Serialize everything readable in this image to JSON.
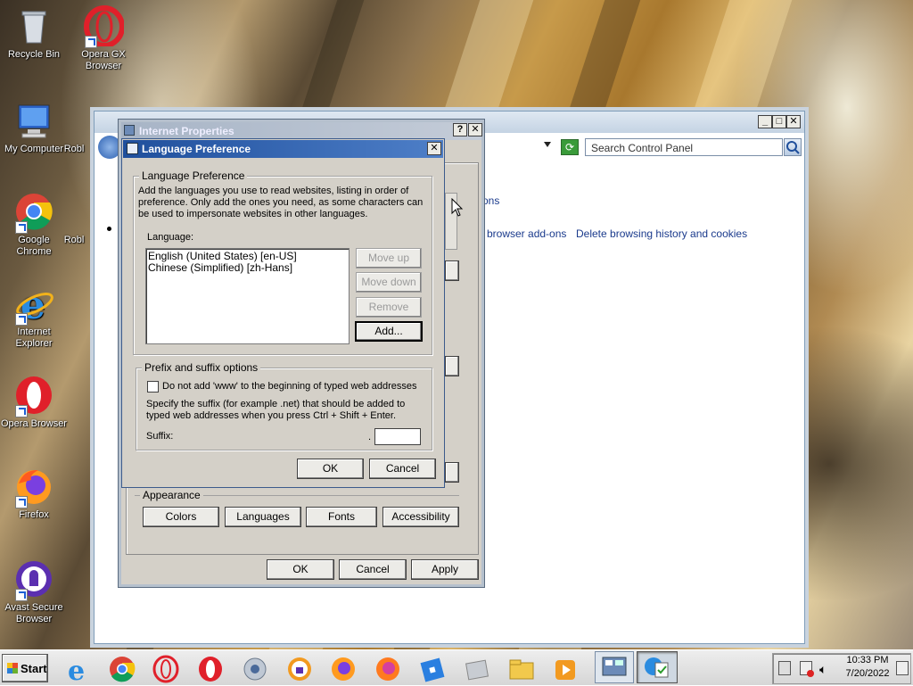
{
  "desktop_icons": [
    {
      "label": "Recycle Bin",
      "icon": "recycle-bin-icon"
    },
    {
      "label": "Opera GX Browser",
      "icon": "opera-gx-icon"
    },
    {
      "label": "My Computer",
      "icon": "my-computer-icon"
    },
    {
      "label": "Robl",
      "icon": "roblox-icon"
    },
    {
      "label": "Google Chrome",
      "icon": "chrome-icon"
    },
    {
      "label": "Robl",
      "icon": "roblox-icon"
    },
    {
      "label": "Internet Explorer",
      "icon": "ie-icon"
    },
    {
      "label": "Opera Browser",
      "icon": "opera-icon"
    },
    {
      "label": "Firefox",
      "icon": "firefox-icon"
    },
    {
      "label": "Avast Secure Browser",
      "icon": "avast-icon"
    }
  ],
  "control_panel": {
    "search_placeholder": "Search Control Panel",
    "link_partial": "ons",
    "link_addons": "browser add-ons",
    "link_delete": "Delete browsing history and cookies"
  },
  "internet_properties": {
    "title": "Internet Properties",
    "help_label": "?",
    "close_label": "✕",
    "appearance_label": "Appearance",
    "colors_button": "Colors",
    "languages_button": "Languages",
    "fonts_button": "Fonts",
    "accessibility_button": "Accessibility",
    "ok_button": "OK",
    "cancel_button": "Cancel",
    "apply_button": "Apply"
  },
  "language_preference": {
    "title": "Language Preference",
    "close_label": "✕",
    "group_label": "Language Preference",
    "description": "Add the languages you use to read websites, listing in order of preference. Only add the ones you need, as some characters can be used to impersonate websites in other languages.",
    "language_label": "Language:",
    "languages": [
      "English (United States) [en-US]",
      "Chinese (Simplified) [zh-Hans]"
    ],
    "move_up_button": "Move up",
    "move_down_button": "Move down",
    "remove_button": "Remove",
    "add_button": "Add...",
    "prefix_group_label": "Prefix and suffix options",
    "www_checkbox_label": "Do not add 'www' to the beginning of typed web addresses",
    "www_checked": false,
    "suffix_description": "Specify the suffix (for example .net) that should be added to typed web addresses when you press Ctrl + Shift + Enter.",
    "suffix_label": "Suffix:",
    "suffix_value": "",
    "ok_button": "OK",
    "cancel_button": "Cancel"
  },
  "taskbar": {
    "start_label": "Start",
    "items": [
      "ie-icon",
      "chrome-icon",
      "opera-gx-icon",
      "opera-icon",
      "media-center-icon",
      "avast-icon",
      "firefox-icon",
      "firefox-icon",
      "roblox-icon",
      "app-icon",
      "file-explorer-icon",
      "media-player-icon",
      "control-panel-icon",
      "internet-options-icon"
    ],
    "clock_time": "10:33 PM",
    "clock_date": "7/20/2022"
  }
}
